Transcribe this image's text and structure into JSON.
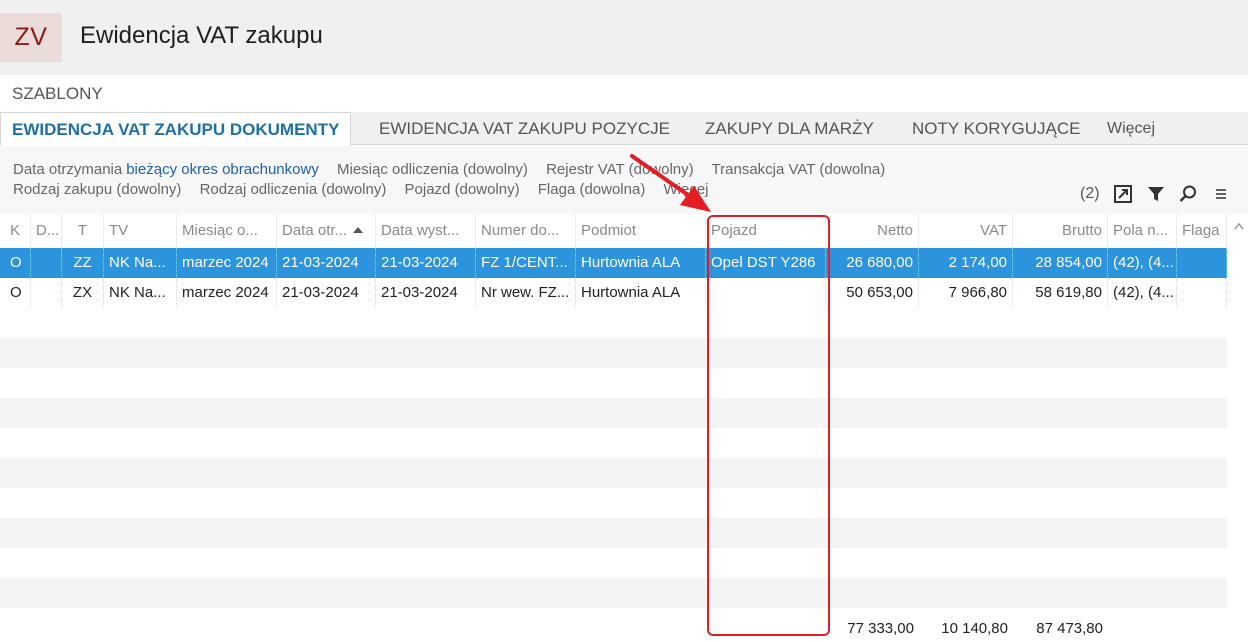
{
  "app": {
    "badge": "ZV",
    "title": "Ewidencja VAT zakupu"
  },
  "templates_label": "SZABLONY",
  "tabs": [
    {
      "label": "EWIDENCJA VAT ZAKUPU DOKUMENTY",
      "active": true
    },
    {
      "label": "EWIDENCJA VAT ZAKUPU POZYCJE",
      "active": false
    },
    {
      "label": "ZAKUPY DLA MARŻY",
      "active": false
    },
    {
      "label": "NOTY KORYGUJĄCE",
      "active": false
    },
    {
      "label": "Więcej",
      "active": false
    }
  ],
  "filters": {
    "row1": [
      {
        "label": "Data otrzymania",
        "value": "bieżący okres obrachunkowy"
      },
      {
        "text": "Miesiąc odliczenia (dowolny)"
      },
      {
        "text": "Rejestr VAT (dowolny)"
      },
      {
        "text": "Transakcja VAT (dowolna)"
      }
    ],
    "row2": [
      {
        "text": "Rodzaj zakupu (dowolny)"
      },
      {
        "text": "Rodzaj odliczenia (dowolny)"
      },
      {
        "text": "Pojazd (dowolny)"
      },
      {
        "text": "Flaga (dowolna)"
      },
      {
        "text": "Więcej"
      }
    ],
    "count": "(2)",
    "tools": [
      "export-icon",
      "filter-icon",
      "search-icon",
      "menu-icon"
    ]
  },
  "grid": {
    "columns": [
      "K",
      "D...",
      "T",
      "TV",
      "Miesiąc o...",
      "Data otr...",
      "Data wyst...",
      "Numer do...",
      "Podmiot",
      "Pojazd",
      "Netto",
      "VAT",
      "Brutto",
      "Pola n...",
      "Flaga"
    ],
    "rows": [
      [
        "O",
        "",
        "ZZ",
        "NK Na...",
        "marzec 2024",
        "21-03-2024",
        "21-03-2024",
        "FZ 1/CENT...",
        "Hurtownia ALA",
        "Opel DST Y286",
        "26 680,00",
        "2 174,00",
        "28 854,00",
        "(42), (4...",
        ""
      ],
      [
        "O",
        "",
        "ZX",
        "NK Na...",
        "marzec 2024",
        "21-03-2024",
        "21-03-2024",
        "Nr wew. FZ...",
        "Hurtownia ALA",
        "",
        "50 653,00",
        "7 966,80",
        "58 619,80",
        "(42), (4...",
        ""
      ]
    ],
    "totals": {
      "netto": "77 333,00",
      "vat": "10 140,80",
      "brutto": "87 473,80"
    }
  },
  "colors": {
    "selection": "#2c93dd",
    "accent_tab": "#1f6fa8",
    "annotation": "#e51c23",
    "badge_bg": "#ecdcd9",
    "badge_text": "#8b1a12"
  }
}
